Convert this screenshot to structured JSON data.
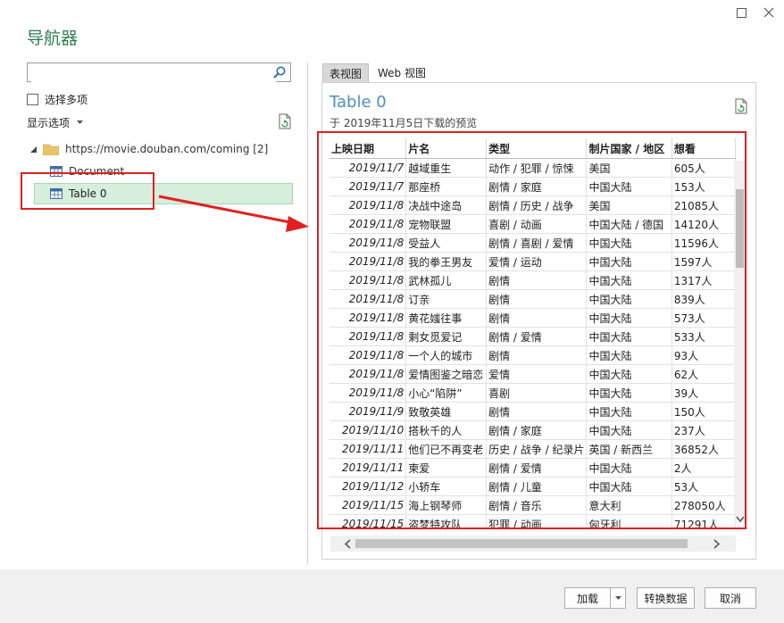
{
  "window": {
    "title": "导航器"
  },
  "left": {
    "search_placeholder": "",
    "select_multiple": "选择多项",
    "display_options": "显示选项",
    "tree_root": "https://movie.douban.com/coming [2]",
    "tree_document": "Document",
    "tree_table": "Table 0"
  },
  "tabs": {
    "table_view": "表视图",
    "web_view": "Web 视图"
  },
  "preview": {
    "title": "Table 0",
    "subtitle": "于 2019年11月5日下载的预览",
    "columns": [
      "上映日期",
      "片名",
      "类型",
      "制片国家 / 地区",
      "想看"
    ],
    "rows": [
      [
        "2019/11/7",
        "越域重生",
        "动作 / 犯罪 / 惊悚",
        "美国",
        "605人"
      ],
      [
        "2019/11/7",
        "那座桥",
        "剧情 / 家庭",
        "中国大陆",
        "153人"
      ],
      [
        "2019/11/8",
        "决战中途岛",
        "剧情 / 历史 / 战争",
        "美国",
        "21085人"
      ],
      [
        "2019/11/8",
        "宠物联盟",
        "喜剧 / 动画",
        "中国大陆 / 德国",
        "14120人"
      ],
      [
        "2019/11/8",
        "受益人",
        "剧情 / 喜剧 / 爱情",
        "中国大陆",
        "11596人"
      ],
      [
        "2019/11/8",
        "我的拳王男友",
        "爱情 / 运动",
        "中国大陆",
        "1597人"
      ],
      [
        "2019/11/8",
        "武林孤儿",
        "剧情",
        "中国大陆",
        "1317人"
      ],
      [
        "2019/11/8",
        "订亲",
        "剧情",
        "中国大陆",
        "839人"
      ],
      [
        "2019/11/8",
        "黄花媸往事",
        "剧情",
        "中国大陆",
        "573人"
      ],
      [
        "2019/11/8",
        "剩女觅爱记",
        "剧情 / 爱情",
        "中国大陆",
        "533人"
      ],
      [
        "2019/11/8",
        "一个人的城市",
        "剧情",
        "中国大陆",
        "93人"
      ],
      [
        "2019/11/8",
        "爱情图鉴之暗恋",
        "爱情",
        "中国大陆",
        "62人"
      ],
      [
        "2019/11/8",
        "小心“陷阱”",
        "喜剧",
        "中国大陆",
        "39人"
      ],
      [
        "2019/11/9",
        "致敬英雄",
        "剧情",
        "中国大陆",
        "150人"
      ],
      [
        "2019/11/10",
        "搭秋千的人",
        "剧情 / 家庭",
        "中国大陆",
        "237人"
      ],
      [
        "2019/11/11",
        "他们已不再变老",
        "历史 / 战争 / 纪录片",
        "英国 / 新西兰",
        "36852人"
      ],
      [
        "2019/11/11",
        "柬爱",
        "剧情 / 爱情",
        "中国大陆",
        "2人"
      ],
      [
        "2019/11/12",
        "小轿车",
        "剧情 / 儿童",
        "中国大陆",
        "53人"
      ],
      [
        "2019/11/15",
        "海上钢琴师",
        "剧情 / 音乐",
        "意大利",
        "278050人"
      ],
      [
        "2019/11/15",
        "盗梦特攻队",
        "犯罪 / 动画",
        "匈牙利",
        "71291人"
      ]
    ]
  },
  "footer": {
    "load": "加载",
    "transform": "转换数据",
    "cancel": "取消"
  },
  "colors": {
    "accent_green": "#2e7d4f",
    "selection": "#d6eedc",
    "highlight_red": "#e02020",
    "title_blue": "#4f8fb8"
  }
}
